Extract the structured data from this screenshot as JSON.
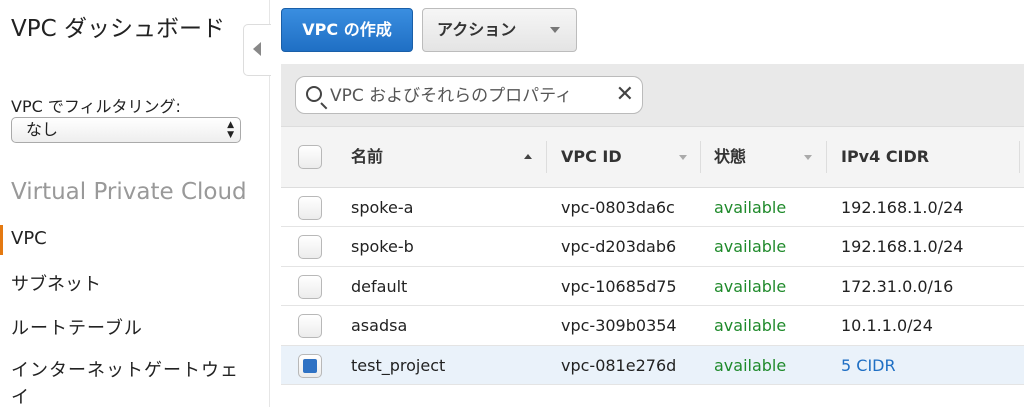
{
  "sidebar": {
    "title": "VPC ダッシュボード",
    "filter_label": "VPC でフィルタリング:",
    "filter_value": "なし",
    "section": "Virtual Private Cloud",
    "items": [
      {
        "label": "VPC",
        "active": true
      },
      {
        "label": "サブネット"
      },
      {
        "label": "ルートテーブル"
      },
      {
        "label": "インターネットゲートウェイ"
      }
    ]
  },
  "toolbar": {
    "create_label": "VPC の作成",
    "actions_label": "アクション"
  },
  "search": {
    "placeholder": "VPC およびそれらのプロパティ"
  },
  "table": {
    "columns": [
      "名前",
      "VPC ID",
      "状態",
      "IPv4 CIDR"
    ],
    "rows": [
      {
        "name": "spoke-a",
        "vpc_id": "vpc-0803da6c",
        "state": "available",
        "cidr": "192.168.1.0/24",
        "selected": false
      },
      {
        "name": "spoke-b",
        "vpc_id": "vpc-d203dab6",
        "state": "available",
        "cidr": "192.168.1.0/24",
        "selected": false
      },
      {
        "name": "default",
        "vpc_id": "vpc-10685d75",
        "state": "available",
        "cidr": "172.31.0.0/16",
        "selected": false
      },
      {
        "name": "asadsa",
        "vpc_id": "vpc-309b0354",
        "state": "available",
        "cidr": "10.1.1.0/24",
        "selected": false
      },
      {
        "name": "test_project",
        "vpc_id": "vpc-081e276d",
        "state": "available",
        "cidr": "5 CIDR",
        "selected": true
      }
    ]
  },
  "colors": {
    "primary": "#1f6fc4",
    "status_available": "#1f8a2b",
    "active_indicator": "#e47911"
  }
}
